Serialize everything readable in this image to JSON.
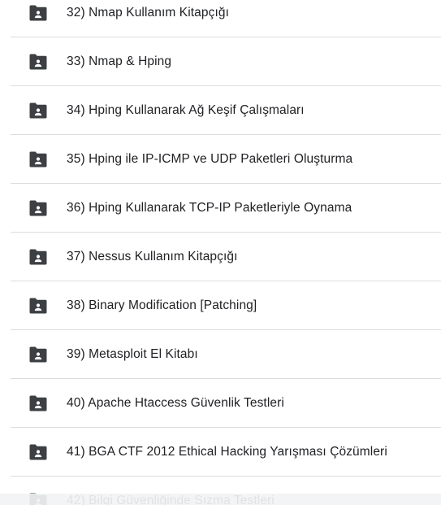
{
  "folders": [
    {
      "label": "32) Nmap Kullanım Kitapçığı",
      "icon": "shared-folder-icon"
    },
    {
      "label": "33) Nmap & Hping",
      "icon": "shared-folder-icon"
    },
    {
      "label": "34) Hping Kullanarak Ağ Keşif Çalışmaları",
      "icon": "shared-folder-icon"
    },
    {
      "label": "35) Hping ile IP-ICMP ve UDP Paketleri Oluşturma",
      "icon": "shared-folder-icon"
    },
    {
      "label": "36) Hping Kullanarak TCP-IP Paketleriyle Oynama",
      "icon": "shared-folder-icon"
    },
    {
      "label": "37) Nessus Kullanım Kitapçığı",
      "icon": "shared-folder-icon"
    },
    {
      "label": "38) Binary Modification [Patching]",
      "icon": "shared-folder-icon"
    },
    {
      "label": "39) Metasploit El Kitabı",
      "icon": "shared-folder-icon"
    },
    {
      "label": "40) Apache Htaccess Güvenlik Testleri",
      "icon": "shared-folder-icon"
    },
    {
      "label": "41) BGA CTF 2012 Ethical Hacking Yarışması Çözümleri",
      "icon": "shared-folder-icon"
    },
    {
      "label": "42) Bilgi Güvenliğinde Sızma Testleri",
      "icon": "shared-folder-icon"
    }
  ],
  "colors": {
    "icon": "#3c4043",
    "text": "#202124",
    "divider": "#dadce0",
    "background": "#ffffff"
  }
}
